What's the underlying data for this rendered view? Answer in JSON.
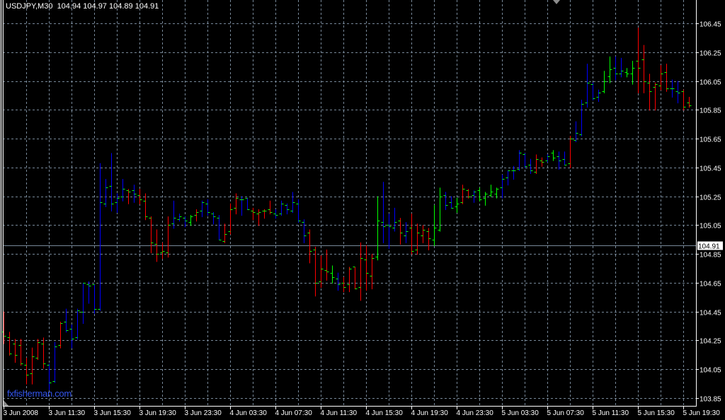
{
  "header": {
    "symbol": "USDJPY,M30",
    "open": "104.94",
    "high": "104.97",
    "low": "104.89",
    "close": "104.91"
  },
  "watermark": "fxfisherman.com",
  "colors": {
    "background": "#000000",
    "grid": "#778899",
    "tick": "#00ff00",
    "r": "#ff0000",
    "b": "#0000ff",
    "g": "#00ff00",
    "price_line": "#778899"
  },
  "chart_data": {
    "type": "ohlc-bar",
    "symbol": "USDJPY",
    "timeframe": "M30",
    "current_price": "104.91",
    "ylim": [
      103.85,
      106.45
    ],
    "grid": true,
    "y_ticks": [
      "106.45",
      "106.25",
      "106.05",
      "105.85",
      "105.65",
      "105.45",
      "105.25",
      "105.05",
      "104.85",
      "104.65",
      "104.45",
      "104.25",
      "104.05",
      "103.85"
    ],
    "x_ticks": [
      "3 Jun 2008",
      "3 Jun 11:30",
      "3 Jun 15:30",
      "3 Jun 19:30",
      "3 Jun 23:30",
      "4 Jun 03:30",
      "4 Jun 07:30",
      "4 Jun 11:30",
      "4 Jun 15:30",
      "4 Jun 19:30",
      "4 Jun 23:30",
      "5 Jun 03:30",
      "5 Jun 07:30",
      "5 Jun 11:30",
      "5 Jun 15:30",
      "5 Jun 19:30"
    ],
    "bars_ohlc": [
      [
        104.31,
        104.45,
        104.23,
        104.28
      ],
      [
        104.27,
        104.31,
        104.15,
        104.16
      ],
      [
        104.23,
        104.26,
        104.1,
        104.15
      ],
      [
        104.22,
        104.26,
        104.08,
        104.09
      ],
      [
        104.08,
        104.13,
        103.95,
        104.01
      ],
      [
        104.02,
        104.2,
        103.95,
        104.14
      ],
      [
        104.13,
        104.26,
        104.12,
        104.24
      ],
      [
        104.23,
        104.27,
        104.06,
        104.09
      ],
      [
        104.08,
        104.09,
        103.91,
        103.96
      ],
      [
        103.97,
        104.24,
        103.96,
        104.21
      ],
      [
        104.22,
        104.38,
        104.2,
        104.37
      ],
      [
        104.38,
        104.47,
        104.31,
        104.32
      ],
      [
        104.33,
        104.36,
        104.2,
        104.26
      ],
      [
        104.27,
        104.47,
        104.26,
        104.46
      ],
      [
        104.45,
        104.65,
        104.37,
        104.65
      ],
      [
        104.64,
        104.66,
        104.51,
        104.63
      ],
      [
        104.64,
        104.64,
        104.44,
        104.47
      ],
      [
        104.47,
        105.48,
        104.46,
        105.21
      ],
      [
        105.2,
        105.37,
        105.18,
        105.31
      ],
      [
        105.32,
        105.55,
        105.15,
        105.2
      ],
      [
        105.21,
        105.27,
        105.14,
        105.24
      ],
      [
        105.25,
        105.37,
        105.22,
        105.3
      ],
      [
        105.29,
        105.3,
        105.2,
        105.28
      ],
      [
        105.29,
        105.33,
        105.21,
        105.27
      ],
      [
        105.26,
        105.3,
        105.2,
        105.23
      ],
      [
        105.22,
        105.27,
        105.09,
        105.11
      ],
      [
        105.1,
        105.11,
        104.86,
        104.93
      ],
      [
        104.92,
        105.02,
        104.8,
        104.85
      ],
      [
        104.86,
        104.93,
        104.82,
        104.87
      ],
      [
        104.86,
        105.11,
        104.83,
        105.05
      ],
      [
        105.06,
        105.22,
        105.03,
        105.1
      ],
      [
        105.09,
        105.13,
        105.08,
        105.11
      ],
      [
        105.1,
        105.11,
        105.04,
        105.08
      ],
      [
        105.07,
        105.12,
        105.05,
        105.11
      ],
      [
        105.12,
        105.16,
        105.08,
        105.14
      ],
      [
        105.15,
        105.22,
        105.11,
        105.21
      ],
      [
        105.2,
        105.23,
        105.12,
        105.14
      ],
      [
        105.13,
        105.14,
        105.06,
        105.11
      ],
      [
        105.1,
        105.12,
        104.95,
        104.95
      ],
      [
        104.94,
        105.06,
        104.93,
        104.99
      ],
      [
        105.01,
        105.2,
        104.99,
        105.16
      ],
      [
        105.17,
        105.27,
        105.13,
        105.24
      ],
      [
        105.23,
        105.25,
        105.12,
        105.23
      ],
      [
        105.24,
        105.24,
        105.16,
        105.16
      ],
      [
        105.15,
        105.17,
        105.09,
        105.14
      ],
      [
        105.13,
        105.16,
        105.05,
        105.14
      ],
      [
        105.15,
        105.16,
        105.1,
        105.15
      ],
      [
        105.16,
        105.22,
        105.13,
        105.14
      ],
      [
        105.13,
        105.16,
        105.1,
        105.12
      ],
      [
        105.13,
        105.22,
        105.12,
        105.2
      ],
      [
        105.19,
        105.2,
        105.13,
        105.16
      ],
      [
        105.15,
        105.28,
        105.14,
        105.21
      ],
      [
        105.2,
        105.23,
        105.07,
        105.08
      ],
      [
        105.07,
        105.09,
        104.93,
        104.98
      ],
      [
        105.0,
        105.02,
        104.79,
        104.87
      ],
      [
        104.88,
        104.9,
        104.56,
        104.65
      ],
      [
        104.66,
        104.84,
        104.62,
        104.75
      ],
      [
        104.74,
        104.88,
        104.67,
        104.73
      ],
      [
        104.72,
        104.77,
        104.65,
        104.69
      ],
      [
        104.68,
        104.72,
        104.6,
        104.64
      ],
      [
        104.65,
        104.69,
        104.59,
        104.62
      ],
      [
        104.64,
        104.76,
        104.59,
        104.75
      ],
      [
        104.76,
        104.76,
        104.61,
        104.61
      ],
      [
        104.62,
        104.93,
        104.53,
        104.82
      ],
      [
        104.81,
        104.91,
        104.6,
        104.72
      ],
      [
        104.7,
        104.85,
        104.61,
        104.82
      ],
      [
        104.83,
        105.25,
        104.81,
        105.08
      ],
      [
        105.07,
        105.35,
        104.93,
        105.04
      ],
      [
        105.05,
        105.13,
        104.89,
        105.04
      ],
      [
        105.03,
        105.17,
        105.01,
        105.07
      ],
      [
        105.08,
        105.1,
        104.92,
        105.0
      ],
      [
        104.98,
        105.07,
        104.93,
        105.01
      ],
      [
        105.03,
        105.13,
        104.85,
        104.87
      ],
      [
        104.88,
        105.06,
        104.85,
        105.0
      ],
      [
        104.98,
        105.05,
        104.93,
        105.02
      ],
      [
        105.01,
        105.03,
        104.88,
        104.96
      ],
      [
        104.95,
        105.19,
        104.91,
        105.03
      ],
      [
        105.02,
        105.31,
        105.01,
        105.25
      ],
      [
        105.26,
        105.28,
        105.16,
        105.19
      ],
      [
        105.21,
        105.25,
        105.17,
        105.17
      ],
      [
        105.18,
        105.24,
        105.14,
        105.2
      ],
      [
        105.21,
        105.33,
        105.2,
        105.3
      ],
      [
        105.29,
        105.3,
        105.24,
        105.25
      ],
      [
        105.26,
        105.29,
        105.21,
        105.28
      ],
      [
        105.29,
        105.31,
        105.22,
        105.23
      ],
      [
        105.24,
        105.28,
        105.19,
        105.27
      ],
      [
        105.26,
        105.33,
        105.25,
        105.28
      ],
      [
        105.27,
        105.31,
        105.24,
        105.3
      ],
      [
        105.31,
        105.4,
        105.24,
        105.37
      ],
      [
        105.38,
        105.43,
        105.33,
        105.43
      ],
      [
        105.43,
        105.46,
        105.37,
        105.43
      ],
      [
        105.44,
        105.57,
        105.43,
        105.55
      ],
      [
        105.54,
        105.55,
        105.45,
        105.46
      ],
      [
        105.47,
        105.51,
        105.41,
        105.43
      ],
      [
        105.42,
        105.54,
        105.41,
        105.51
      ],
      [
        105.5,
        105.52,
        105.46,
        105.49
      ],
      [
        105.5,
        105.54,
        105.49,
        105.53
      ],
      [
        105.55,
        105.57,
        105.5,
        105.52
      ],
      [
        105.53,
        105.56,
        105.44,
        105.5
      ],
      [
        105.51,
        105.56,
        105.47,
        105.47
      ],
      [
        105.48,
        105.67,
        105.45,
        105.65
      ],
      [
        105.64,
        105.77,
        105.63,
        105.69
      ],
      [
        105.68,
        105.92,
        105.67,
        105.89
      ],
      [
        105.9,
        106.17,
        105.87,
        106.04
      ],
      [
        106.03,
        106.04,
        105.92,
        105.93
      ],
      [
        105.94,
        105.99,
        105.91,
        105.97
      ],
      [
        105.98,
        106.12,
        105.97,
        106.05
      ],
      [
        106.08,
        106.22,
        106.04,
        106.13
      ],
      [
        106.14,
        106.22,
        106.06,
        106.1
      ],
      [
        106.1,
        106.21,
        106.08,
        106.12
      ],
      [
        106.11,
        106.14,
        106.08,
        106.1
      ],
      [
        106.1,
        106.19,
        106.03,
        106.14
      ],
      [
        106.19,
        106.42,
        105.97,
        106.14
      ],
      [
        106.2,
        106.3,
        105.97,
        106.05
      ],
      [
        106.04,
        106.1,
        105.85,
        105.98
      ],
      [
        106.01,
        106.04,
        105.85,
        106.03
      ],
      [
        106.02,
        106.16,
        105.99,
        106.1
      ],
      [
        106.11,
        106.17,
        105.98,
        106.0
      ],
      [
        106.0,
        106.06,
        105.94,
        106.0
      ],
      [
        105.98,
        106.05,
        105.9,
        105.97
      ],
      [
        105.98,
        105.99,
        105.85,
        105.87
      ],
      [
        105.9,
        105.94,
        105.87,
        105.88
      ]
    ],
    "bar_colors": "rrrrrrrrbbrbbbbbbbbbbbrbrrrrrrbbbgrbbbbrrrbbrrrrbbbbbbrrrrgbrrrrrrgbbbrbrrrrggbbgrrbggggbbbbbbrrbgbbrbbbbbggbbggrrrrrrbbrr"
  }
}
